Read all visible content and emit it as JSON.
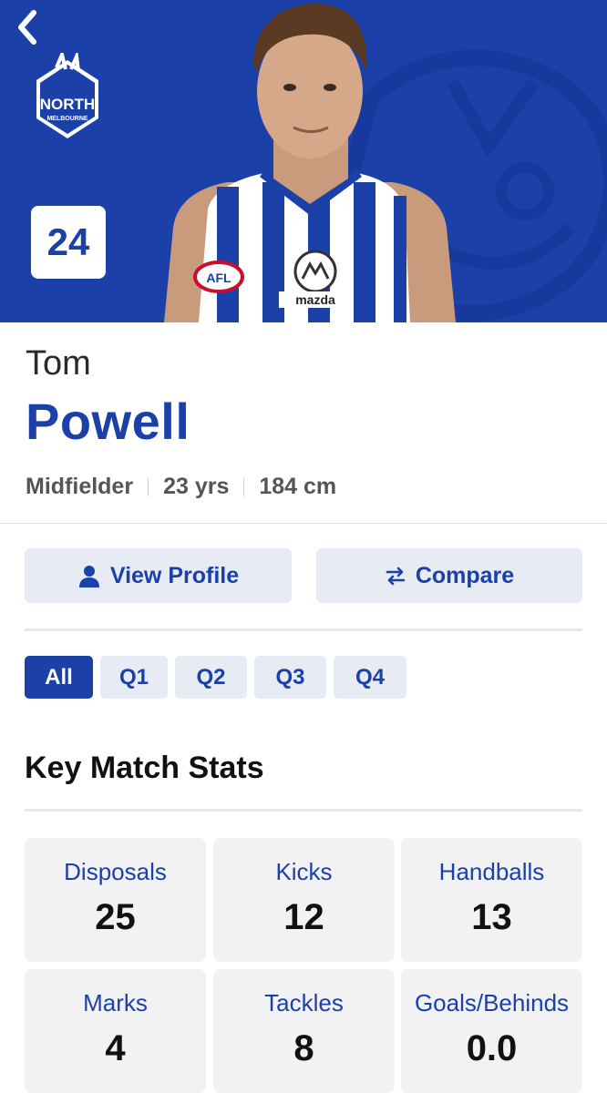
{
  "header": {
    "back_icon": "chevron-left-icon",
    "club_logo_text": "NORTH",
    "club_logo_sub": "MELBOURNE",
    "jersey_number": "24"
  },
  "player": {
    "first_name": "Tom",
    "last_name": "Powell",
    "position": "Midfielder",
    "age": "23 yrs",
    "height": "184 cm"
  },
  "actions": {
    "view_profile": "View Profile",
    "view_profile_icon": "person-icon",
    "compare": "Compare",
    "compare_icon": "swap-arrows-icon"
  },
  "quarters": {
    "tabs": [
      "All",
      "Q1",
      "Q2",
      "Q3",
      "Q4"
    ],
    "selected": "All"
  },
  "stats": {
    "title": "Key Match Stats",
    "items": [
      {
        "label": "Disposals",
        "value": "25"
      },
      {
        "label": "Kicks",
        "value": "12"
      },
      {
        "label": "Handballs",
        "value": "13"
      },
      {
        "label": "Marks",
        "value": "4"
      },
      {
        "label": "Tackles",
        "value": "8"
      },
      {
        "label": "Goals/Behinds",
        "value": "0.0"
      }
    ]
  },
  "colors": {
    "brand_blue": "#1b40a8",
    "button_bg": "#e6ebf4",
    "card_bg": "#f2f2f4"
  }
}
